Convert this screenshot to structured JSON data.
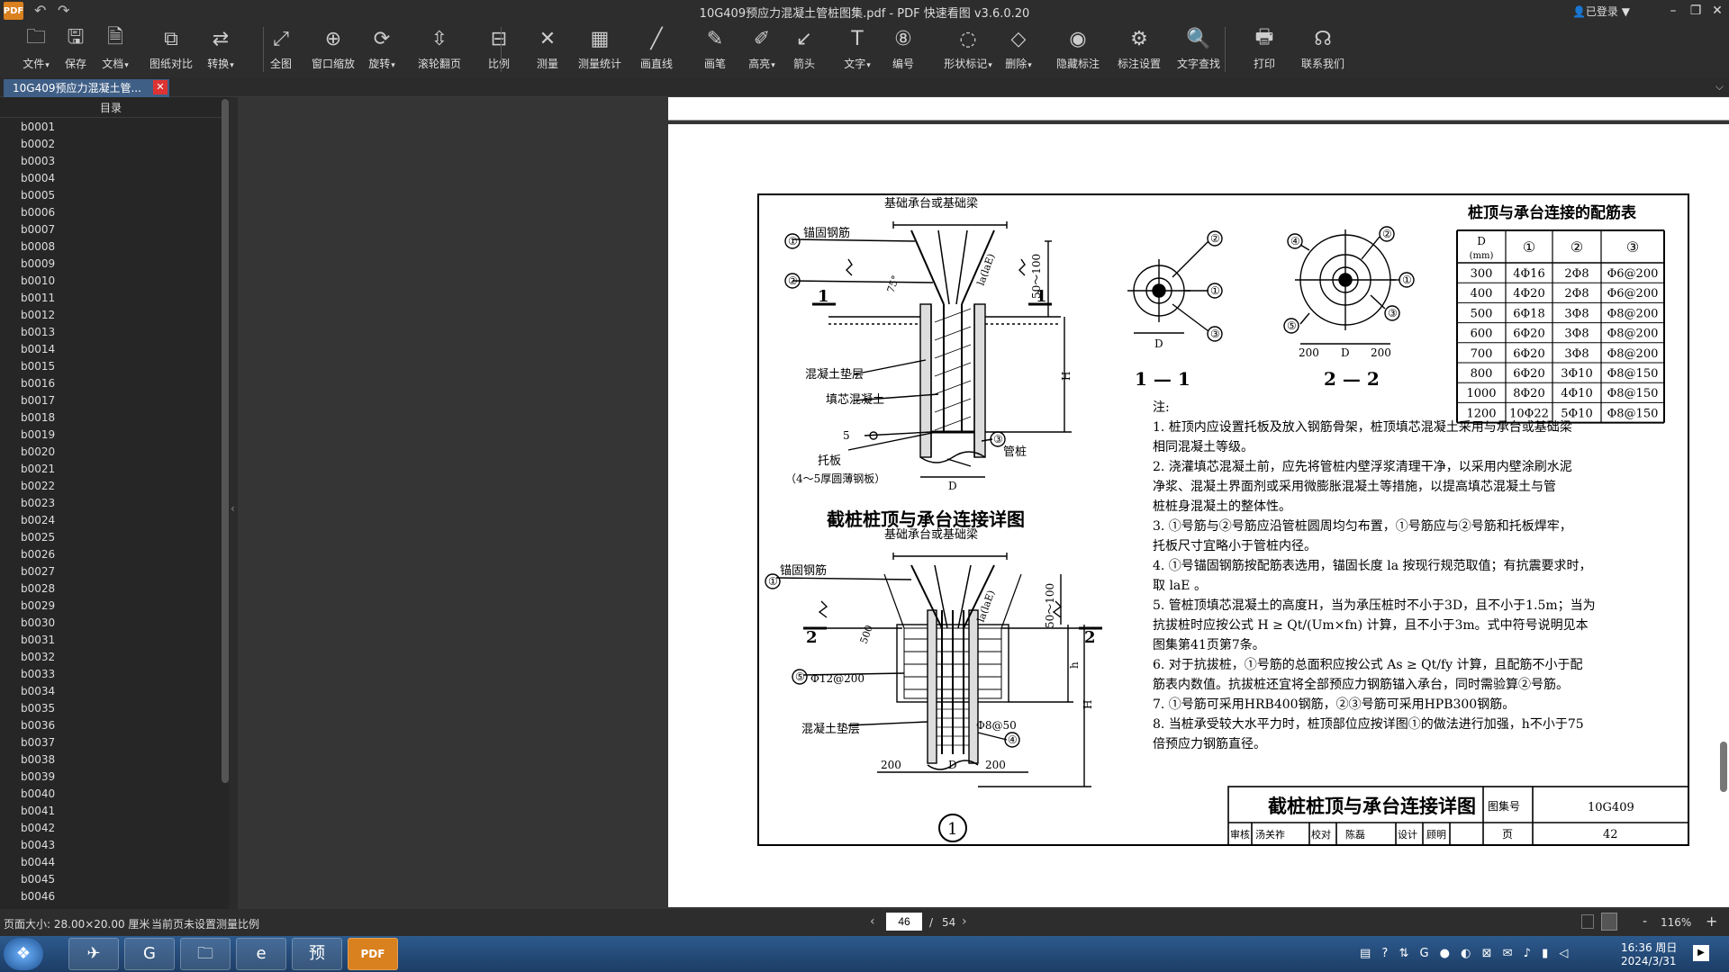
{
  "window": {
    "logo": "PDF",
    "title": "10G409预应力混凝土管桩图集.pdf - PDF 快速看图 v3.6.0.20",
    "login": "已登录",
    "undo_glyph": "↶",
    "redo_glyph": "↷",
    "minimize": "–",
    "maximize": "❐",
    "close": "✕"
  },
  "toolbar": {
    "items": [
      {
        "label": "文件",
        "icon": "folder-icon",
        "glyph": "🗀"
      },
      {
        "label": "保存",
        "icon": "save-icon",
        "glyph": "🖫"
      },
      {
        "label": "文档",
        "icon": "document-icon",
        "glyph": "🗎"
      },
      {
        "label": "图纸对比",
        "icon": "compare-icon",
        "glyph": "⧉"
      },
      {
        "label": "转换",
        "icon": "convert-icon",
        "glyph": "⇄"
      },
      {
        "label": "全图",
        "icon": "fit-all-icon",
        "glyph": "⤢"
      },
      {
        "label": "窗口缩放",
        "icon": "zoom-window-icon",
        "glyph": "⊕"
      },
      {
        "label": "旋转",
        "icon": "rotate-icon",
        "glyph": "⟳"
      },
      {
        "label": "滚轮翻页",
        "icon": "scroll-page-icon",
        "glyph": "⇳"
      },
      {
        "label": "比例",
        "icon": "scale-icon",
        "glyph": "⊟"
      },
      {
        "label": "测量",
        "icon": "measure-icon",
        "glyph": "✕"
      },
      {
        "label": "测量统计",
        "icon": "measure-stats-icon",
        "glyph": "▦"
      },
      {
        "label": "画直线",
        "icon": "line-icon",
        "glyph": "╱"
      },
      {
        "label": "画笔",
        "icon": "pen-icon",
        "glyph": "✎"
      },
      {
        "label": "高亮",
        "icon": "highlighter-icon",
        "glyph": "✐"
      },
      {
        "label": "箭头",
        "icon": "arrow-icon",
        "glyph": "↙"
      },
      {
        "label": "文字",
        "icon": "text-icon",
        "glyph": "T"
      },
      {
        "label": "编号",
        "icon": "numbering-icon",
        "glyph": "⑧"
      },
      {
        "label": "形状标记",
        "icon": "shape-mark-icon",
        "glyph": "◌"
      },
      {
        "label": "删除",
        "icon": "eraser-icon",
        "glyph": "◇"
      },
      {
        "label": "隐藏标注",
        "icon": "hide-mark-icon",
        "glyph": "◉"
      },
      {
        "label": "标注设置",
        "icon": "mark-settings-icon",
        "glyph": "⚙"
      },
      {
        "label": "文字查找",
        "icon": "search-icon",
        "glyph": "🔍"
      },
      {
        "label": "打印",
        "icon": "print-icon",
        "glyph": "🖶"
      },
      {
        "label": "联系我们",
        "icon": "headset-icon",
        "glyph": "☊"
      }
    ]
  },
  "tab": {
    "label": "10G409预应力混凝土管...",
    "close": "✕",
    "dropdown": "⌵"
  },
  "sidebar": {
    "header": "目录",
    "collapse": "‹",
    "items": [
      "b0001",
      "b0002",
      "b0003",
      "b0004",
      "b0005",
      "b0006",
      "b0007",
      "b0008",
      "b0009",
      "b0010",
      "b0011",
      "b0012",
      "b0013",
      "b0014",
      "b0015",
      "b0016",
      "b0017",
      "b0018",
      "b0019",
      "b0020",
      "b0021",
      "b0022",
      "b0023",
      "b0024",
      "b0025",
      "b0026",
      "b0027",
      "b0028",
      "b0029",
      "b0030",
      "b0031",
      "b0032",
      "b0033",
      "b0034",
      "b0035",
      "b0036",
      "b0037",
      "b0038",
      "b0039",
      "b0040",
      "b0041",
      "b0042",
      "b0043",
      "b0044",
      "b0045",
      "b0046"
    ]
  },
  "drawing": {
    "top_detail": {
      "cap_label": "基础承台或基础梁",
      "anchor_label": "锚固钢筋",
      "pad_label": "混凝土垫层",
      "fill_label": "填芯混凝土",
      "plate_label": "托板",
      "plate_note": "（4～5厚圆薄钢板）",
      "pipe_label": "管桩",
      "dim_50_100": "50～100",
      "dim_H": "H",
      "dim_D": "D",
      "dim_5": "5",
      "angle": "75°",
      "la": "la(laE)",
      "sec": "1",
      "c1": "①",
      "c2": "②",
      "c3": "③",
      "title": "截桩桩顶与承台连接详图"
    },
    "bottom_detail": {
      "cap_label": "基础承台或基础梁",
      "anchor_label": "锚固钢筋",
      "pad_label": "混凝土垫层",
      "stirrup": "Φ12@200",
      "spiral": "Φ8@50",
      "dim_500": "500",
      "dim_50_100": "50～100",
      "dim_h": "h",
      "dim_H": "H",
      "dim_200a": "200",
      "dim_D": "D",
      "dim_200b": "200",
      "la": "la(laE)",
      "sec": "2",
      "c1": "①",
      "c4": "④",
      "c5": "⑤",
      "detail_no": "1"
    },
    "section_1": {
      "label": "1 — 1",
      "dim_D": "D",
      "c1": "①",
      "c2": "②",
      "c3": "③"
    },
    "section_2": {
      "label": "2 — 2",
      "dim_200a": "200",
      "dim_D": "D",
      "dim_200b": "200",
      "c1": "①",
      "c2": "②",
      "c3": "③",
      "c4": "④",
      "c5": "⑤"
    },
    "rebar_table": {
      "title": "桩顶与承台连接的配筋表",
      "headers": [
        "D",
        "①",
        "②",
        "③"
      ],
      "header_unit": "(mm)",
      "rows": [
        [
          "300",
          "4Φ16",
          "2Φ8",
          "Φ6@200"
        ],
        [
          "400",
          "4Φ20",
          "2Φ8",
          "Φ6@200"
        ],
        [
          "500",
          "6Φ18",
          "3Φ8",
          "Φ8@200"
        ],
        [
          "600",
          "6Φ20",
          "3Φ8",
          "Φ8@200"
        ],
        [
          "700",
          "6Φ20",
          "3Φ8",
          "Φ8@200"
        ],
        [
          "800",
          "6Φ20",
          "3Φ10",
          "Φ8@150"
        ],
        [
          "1000",
          "8Φ20",
          "4Φ10",
          "Φ8@150"
        ],
        [
          "1200",
          "10Φ22",
          "5Φ10",
          "Φ8@150"
        ]
      ]
    },
    "notes": {
      "heading": "注:",
      "lines": [
        "1. 桩顶内应设置托板及放入钢筋骨架，桩顶填芯混凝土采用与承台或基础梁",
        "    相同混凝土等级。",
        "2. 浇灌填芯混凝土前，应先将管桩内壁浮浆清理干净，以采用内壁涂刷水泥",
        "    净浆、混凝土界面剂或采用微膨胀混凝土等措施，以提高填芯混凝土与管",
        "    桩桩身混凝土的整体性。",
        "3. ①号筋与②号筋应沿管桩圆周均匀布置，①号筋应与②号筋和托板焊牢，",
        "    托板尺寸宜略小于管桩内径。",
        "4. ①号锚固钢筋按配筋表选用，锚固长度 la 按现行规范取值；有抗震要求时，",
        "    取 laE 。",
        "5. 管桩顶填芯混凝土的高度H，当为承压桩时不小于3D，且不小于1.5m；当为",
        "    抗拔桩时应按公式 H ≥ Qt/(Um×fn) 计算，且不小于3m。式中符号说明见本",
        "    图集第41页第7条。",
        "6. 对于抗拔桩，①号筋的总面积应按公式 As ≥ Qt/fy 计算，且配筋不小于配",
        "    筋表内数值。抗拔桩还宜将全部预应力钢筋锚入承台，同时需验算②号筋。",
        "7. ①号筋可采用HRB400钢筋，②③号筋可采用HPB300钢筋。",
        "8. 当桩承受较大水平力时，桩顶部位应按详图①的做法进行加强，h不小于75",
        "    倍预应力钢筋直径。"
      ]
    },
    "title_block": {
      "title": "截桩桩顶与承台连接详图",
      "atlas_label": "图集号",
      "atlas_no": "10G409",
      "review_label": "审核",
      "reviewer": "汤关祚",
      "check_label": "校对",
      "checker": "陈磊",
      "design_label": "设计",
      "designer": "顾明",
      "page_label": "页",
      "page_no": "42"
    }
  },
  "status": {
    "page_size": "页面大小: 28.00×20.00 厘米",
    "scale": "当前页未设置测量比例",
    "current_page": "46",
    "sep": "/",
    "total_pages": "54",
    "prev": "‹",
    "next": "›",
    "zoom_out": "-",
    "zoom": "116%",
    "zoom_in": "+"
  },
  "taskbar": {
    "start": "❖",
    "apps": [
      {
        "name": "taskbar-app-feishu",
        "glyph": "✈"
      },
      {
        "name": "taskbar-app-browser",
        "glyph": "G"
      },
      {
        "name": "taskbar-app-explorer",
        "glyph": "🗀"
      },
      {
        "name": "taskbar-app-ie",
        "glyph": "e"
      },
      {
        "name": "taskbar-app-preview",
        "glyph": "预"
      },
      {
        "name": "taskbar-app-pdf",
        "glyph": "PDF"
      }
    ],
    "tray": "▤ ? ⇅ G ● ◐ ⊠ ✉ ♪ ▮ ◁",
    "time": "16:36 周日",
    "date": "2024/3/31",
    "desktop": "▶"
  }
}
